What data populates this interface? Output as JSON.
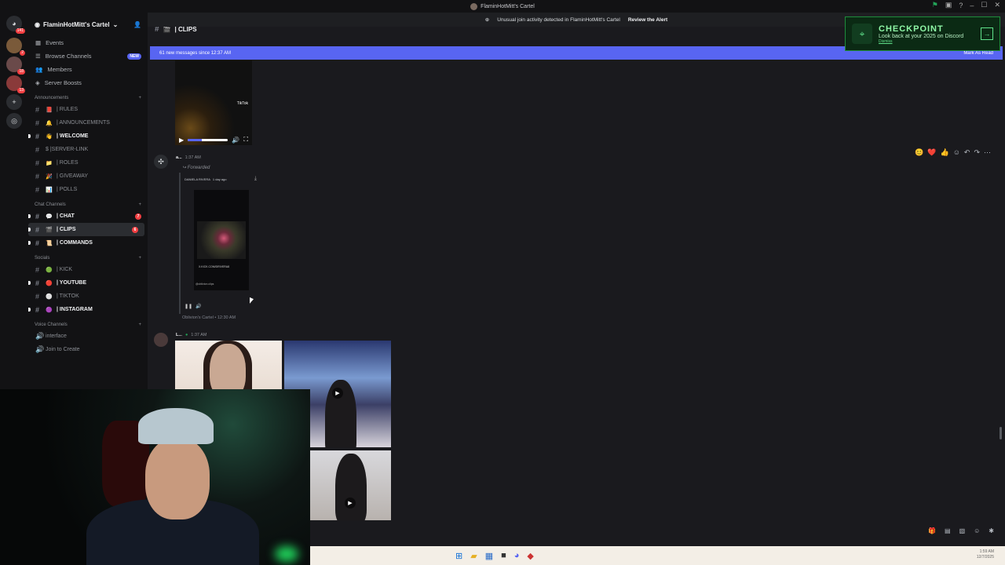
{
  "window": {
    "title": "FlaminHotMitt's Cartel"
  },
  "alert": {
    "text": "Unusual join activity detected in FlaminHotMitt's Cartel",
    "action": "Review the Alert"
  },
  "checkpoint": {
    "title": "CHECKPOINT",
    "subtitle": "Look back at your 2025 on Discord",
    "dismiss": "Dismiss",
    "arrow_icon": "arrow-right-icon"
  },
  "rail": {
    "home_badge": "141",
    "badges": [
      "2",
      "18",
      "13"
    ]
  },
  "server": {
    "name": "FlaminHotMitt's Cartel"
  },
  "nav": [
    {
      "label": "Events",
      "icon": "calendar-icon"
    },
    {
      "label": "Browse Channels",
      "icon": "browse-icon",
      "badge": "NEW"
    },
    {
      "label": "Members",
      "icon": "members-icon"
    },
    {
      "label": "Server Boosts",
      "icon": "boost-icon"
    }
  ],
  "categories": {
    "announcements": "Announcements",
    "chat": "Chat Channels",
    "socials": "Socials",
    "voice": "Voice Channels"
  },
  "channels": {
    "announcements": [
      {
        "emoji": "📕",
        "label": "| RULES",
        "bold": false
      },
      {
        "emoji": "🔔",
        "label": "| ANNOUNCEMENTS",
        "bold": false
      },
      {
        "emoji": "👋",
        "label": "| WELCOME",
        "bold": true
      },
      {
        "emoji": "",
        "label": "$ |SERVER-LINK",
        "bold": false
      },
      {
        "emoji": "📁",
        "label": "| ROLES",
        "bold": false
      },
      {
        "emoji": "🎉",
        "label": "| GIVEAWAY",
        "bold": false
      },
      {
        "emoji": "📊",
        "label": "| POLLS",
        "bold": false
      }
    ],
    "chat": [
      {
        "emoji": "💬",
        "label": "| CHAT",
        "bold": true,
        "badge": "7"
      },
      {
        "emoji": "🎬",
        "label": "| CLIPS",
        "bold": true,
        "badge": "6",
        "active": true
      },
      {
        "emoji": "📜",
        "label": "| COMMANDS",
        "bold": true
      }
    ],
    "socials": [
      {
        "emoji": "🟢",
        "label": "| KICK",
        "bold": false
      },
      {
        "emoji": "🔴",
        "label": "| YOUTUBE",
        "bold": true
      },
      {
        "emoji": "⚪",
        "label": "| TIKTOK",
        "bold": false
      },
      {
        "emoji": "🟣",
        "label": "| INSTAGRAM",
        "bold": true
      }
    ],
    "voice": [
      {
        "label": "interface"
      },
      {
        "label": "Join to Create"
      }
    ]
  },
  "channel_header": {
    "name": "| CLIPS"
  },
  "new_messages": {
    "text": "61 new messages since 12:37 AM",
    "action": "Mark As Read"
  },
  "message1": {
    "watermark": "TikTok",
    "progress": 0.35
  },
  "message2": {
    "author": "a...",
    "time": "1:37 AM",
    "forwarded_label": "Forwarded",
    "embed_author": "DANIELA RIVERA",
    "embed_age": "1 day ago",
    "embed_caption": "X.KICK.COM/DRIVERA8",
    "embed_user": "@oblivion.clips",
    "source": "Oblivion's Cartel • 12:30 AM"
  },
  "message3": {
    "author": "L...",
    "time": "1:37 AM"
  },
  "reactions": [
    "😊",
    "❤️",
    "👍"
  ],
  "taskbar": {
    "time": "1:59 AM",
    "date": "12/7/2025"
  }
}
